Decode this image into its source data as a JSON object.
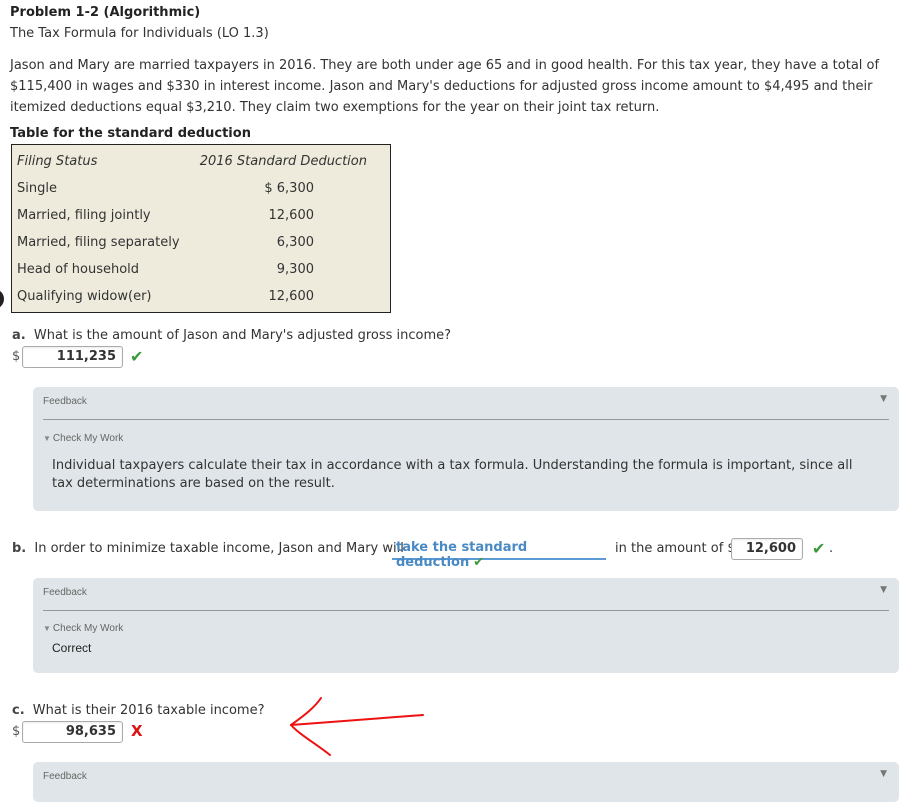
{
  "problem": {
    "title": "Problem 1-2 (Algorithmic)",
    "subtitle": "The Tax Formula for Individuals (LO 1.3)",
    "intro": "Jason and Mary are married taxpayers in 2016. They are both under age 65 and in good health. For this tax year, they have a total of $115,400 in wages and $330 in interest income. Jason and Mary's deductions for adjusted gross income amount to $4,495 and their itemized deductions equal $3,210. They claim two exemptions for the year on their joint tax return."
  },
  "standard_deduction_table": {
    "caption": "Table for the standard deduction",
    "headers": [
      "Filing Status",
      "2016 Standard Deduction"
    ],
    "rows": [
      {
        "status": "Single",
        "amount": "$ 6,300"
      },
      {
        "status": "Married, filing jointly",
        "amount": "12,600"
      },
      {
        "status": "Married, filing separately",
        "amount": "6,300"
      },
      {
        "status": "Head of household",
        "amount": "9,300"
      },
      {
        "status": "Qualifying widow(er)",
        "amount": "12,600"
      }
    ]
  },
  "questions": {
    "a": {
      "label": "a.",
      "text": "What is the amount of Jason and Mary's adjusted gross income?",
      "currency": "$",
      "answer": "111,235",
      "result": "correct",
      "result_icon": "✔"
    },
    "b": {
      "label": "b.",
      "text_before": "In order to minimize taxable income, Jason and Mary will",
      "dropdown_selected": "take the standard deduction",
      "dropdown_result_icon": "✔",
      "text_after": "in the amount of $",
      "answer": "12,600",
      "result": "correct",
      "result_icon": "✔",
      "trailing": "."
    },
    "c": {
      "label": "c.",
      "text": "What is their 2016 taxable income?",
      "currency": "$",
      "answer": "98,635",
      "result": "incorrect",
      "result_icon": "X"
    }
  },
  "feedback_a": {
    "label": "Feedback",
    "toggle_icon": "▼",
    "check_my_work": "Check My Work",
    "check_icon": "▼",
    "text": "Individual taxpayers calculate their tax in accordance with a tax formula. Understanding the formula is important, since all tax determinations are based on the result."
  },
  "feedback_b": {
    "label": "Feedback",
    "toggle_icon": "▼",
    "check_my_work": "Check My Work",
    "check_icon": "▼",
    "text": "Correct"
  },
  "feedback_c": {
    "label": "Feedback",
    "toggle_icon": "▼"
  },
  "colors": {
    "correct": "#3a9a3a",
    "incorrect": "#dd1111",
    "annotation": "#ee1111",
    "dropdown_accent": "#5b9bd5",
    "feedback_bg": "#dfe5e8",
    "table_bg": "#eeebdd"
  }
}
